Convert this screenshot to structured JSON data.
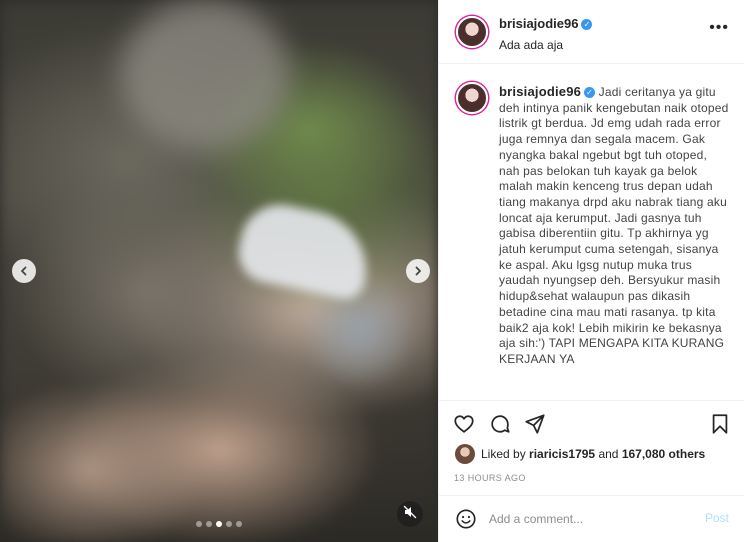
{
  "post": {
    "username": "brisiajodie96",
    "location": "Ada ada aja",
    "caption": "Jadi ceritanya ya gitu deh intinya panik kengebutan naik otoped listrik gt berdua. Jd emg udah rada error juga remnya dan segala macem. Gak nyangka bakal ngebut bgt tuh otoped, nah pas belokan tuh kayak ga belok malah makin kenceng trus depan udah tiang makanya drpd aku nabrak tiang aku loncat aja kerumput. Jadi gasnya tuh gabisa diberentiin gitu. Tp akhirnya yg jatuh kerumput cuma setengah, sisanya ke aspal. Aku lgsg nutup muka trus yaudah nyungsep deh. Bersyukur masih hidup&sehat walaupun pas dikasih betadine cina mau mati rasanya. tp kita baik2 aja kok! Lebih mikirin ke bekasnya aja sih:') TAPI MENGAPA KITA KURANG KERJAAN YA",
    "likes_prefix": "Liked by",
    "liked_by_user": "riaricis1795",
    "likes_and": "and",
    "likes_count": "167,080 others",
    "timestamp": "13 HOURS AGO"
  },
  "comment": {
    "placeholder": "Add a comment...",
    "post_label": "Post"
  },
  "carousel": {
    "slide_count": 5,
    "active_index": 2
  },
  "icons": {
    "more": "more-options-icon",
    "like": "heart-icon",
    "comment": "comment-icon",
    "share": "share-icon",
    "save": "bookmark-icon",
    "emoji": "emoji-icon",
    "mute": "mute-icon",
    "prev": "chevron-left-icon",
    "next": "chevron-right-icon"
  },
  "colors": {
    "verified": "#3897f0",
    "post_button_disabled": "#b3dbff",
    "story_ring": "#d6249f"
  }
}
